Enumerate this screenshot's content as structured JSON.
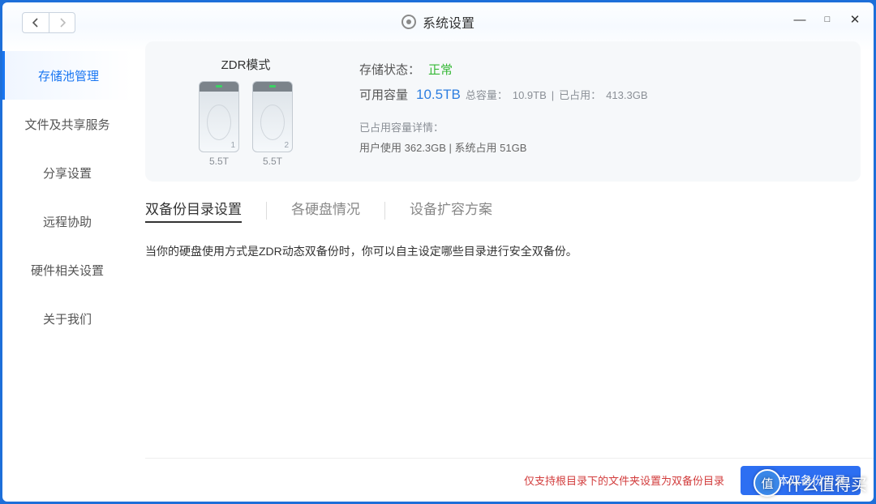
{
  "titlebar": {
    "title": "系统设置",
    "minimize": "—",
    "maximize": "□",
    "close": "✕"
  },
  "sidebar": {
    "items": [
      {
        "label": "存储池管理",
        "active": true
      },
      {
        "label": "文件及共享服务",
        "active": false
      },
      {
        "label": "分享设置",
        "active": false
      },
      {
        "label": "远程协助",
        "active": false
      },
      {
        "label": "硬件相关设置",
        "active": false
      },
      {
        "label": "关于我们",
        "active": false
      }
    ]
  },
  "storage": {
    "mode_label": "ZDR模式",
    "disks": [
      {
        "num": "1",
        "capacity": "5.5T"
      },
      {
        "num": "2",
        "capacity": "5.5T"
      }
    ],
    "status_label": "存储状态：",
    "status_value": "正常",
    "avail_label": "可用容量",
    "avail_value": "10.5TB",
    "total_label": "总容量：",
    "total_value": "10.9TB",
    "used_label": "已占用：",
    "used_value": "413.3GB",
    "detail_label": "已占用容量详情：",
    "detail_value": "用户使用 362.3GB | 系统占用 51GB"
  },
  "tabs": [
    {
      "label": "双备份目录设置",
      "active": true
    },
    {
      "label": "各硬盘情况",
      "active": false
    },
    {
      "label": "设备扩容方案",
      "active": false
    }
  ],
  "description": "当你的硬盘使用方式是ZDR动态双备份时，你可以自主设定哪些目录进行安全双备份。",
  "footer": {
    "note": "仅支持根目录下的文件夹设置为双备份目录",
    "button": "管理本双备份目录"
  },
  "watermark": {
    "badge": "值",
    "text": "什么值得买"
  }
}
